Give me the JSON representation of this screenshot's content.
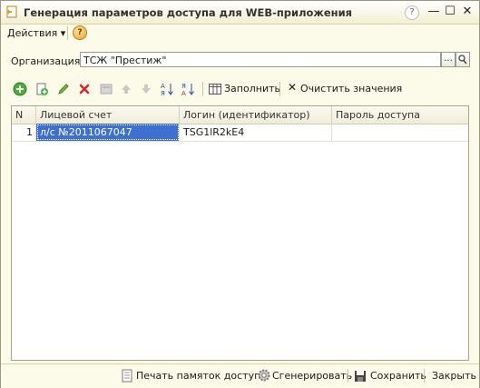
{
  "window": {
    "title": "Генерация параметров доступа для WEB-приложения",
    "controls": {
      "help": "?",
      "minimize": "—",
      "maximize": "☐",
      "close": "✕"
    }
  },
  "menu": {
    "actions_label": "Действия ▾",
    "help_icon": "question-icon"
  },
  "organization": {
    "label": "Организация:",
    "value": "ТСЖ \"Престиж\"",
    "select_button": "...",
    "search_icon": "magnifier-icon"
  },
  "toolbar": {
    "icons": [
      "add-icon",
      "copy-icon",
      "edit-icon",
      "delete-icon",
      "end-edit-icon",
      "move-up-icon",
      "move-down-icon",
      "sort-asc-icon",
      "sort-desc-icon"
    ],
    "fill_label": "Заполнить",
    "clear_label": "Очистить значения"
  },
  "table": {
    "columns": [
      "N",
      "Лицевой счет",
      "Логин (идентификатор)",
      "Пароль доступа"
    ],
    "rows": [
      {
        "n": "1",
        "account": "л/с №2011067047",
        "login": "TSG1lR2kE4",
        "password": ""
      }
    ]
  },
  "footer": {
    "print_label": "Печать памяток доступа",
    "generate_label": "Сгенерировать",
    "save_label": "Сохранить",
    "close_label": "Закрыть"
  },
  "colors": {
    "window_bg": "#fcfae8",
    "selection": "#3f6fd0",
    "border": "#a9a58a"
  }
}
